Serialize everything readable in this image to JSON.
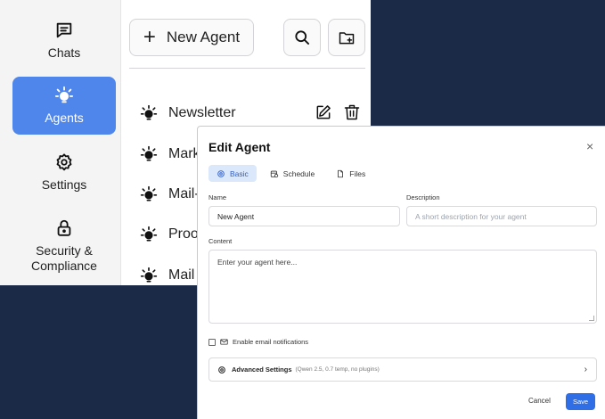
{
  "sidebar": {
    "items": [
      {
        "label": "Chats",
        "icon": "chat-icon"
      },
      {
        "label": "Agents",
        "icon": "lightbulb-icon",
        "active": true
      },
      {
        "label": "Settings",
        "icon": "gear-icon"
      },
      {
        "label": "Security &\nCompliance",
        "icon": "lock-icon"
      }
    ]
  },
  "toolbar": {
    "new_agent_plus": "+",
    "new_agent_label": "New Agent",
    "search_icon": "search-icon",
    "new_folder_icon": "folder-plus-icon"
  },
  "agents": {
    "items": [
      {
        "name": "Newsletter"
      },
      {
        "name": "Mark"
      },
      {
        "name": "Mail-"
      },
      {
        "name": "Proo"
      },
      {
        "name": "Mail"
      }
    ]
  },
  "modal": {
    "title": "Edit Agent",
    "close": "×",
    "tabs": [
      {
        "label": "Basic",
        "active": true
      },
      {
        "label": "Schedule"
      },
      {
        "label": "Files"
      }
    ],
    "name_label": "Name",
    "name_value": "New Agent",
    "description_label": "Description",
    "description_placeholder": "A short description for your agent",
    "content_label": "Content",
    "content_placeholder": "Enter your agent here...",
    "email_notifications_label": "Enable email notifications",
    "advanced_label": "Advanced Settings",
    "advanced_summary": "(Qwen 2.5, 0.7 temp, no plugins)",
    "advanced_chevron": "›",
    "cancel_label": "Cancel",
    "save_label": "Save"
  },
  "colors": {
    "background": "#1b2a47",
    "accent": "#4f86ec",
    "primary_button": "#2f6ee5",
    "active_tab_bg": "#dbe7fb"
  }
}
